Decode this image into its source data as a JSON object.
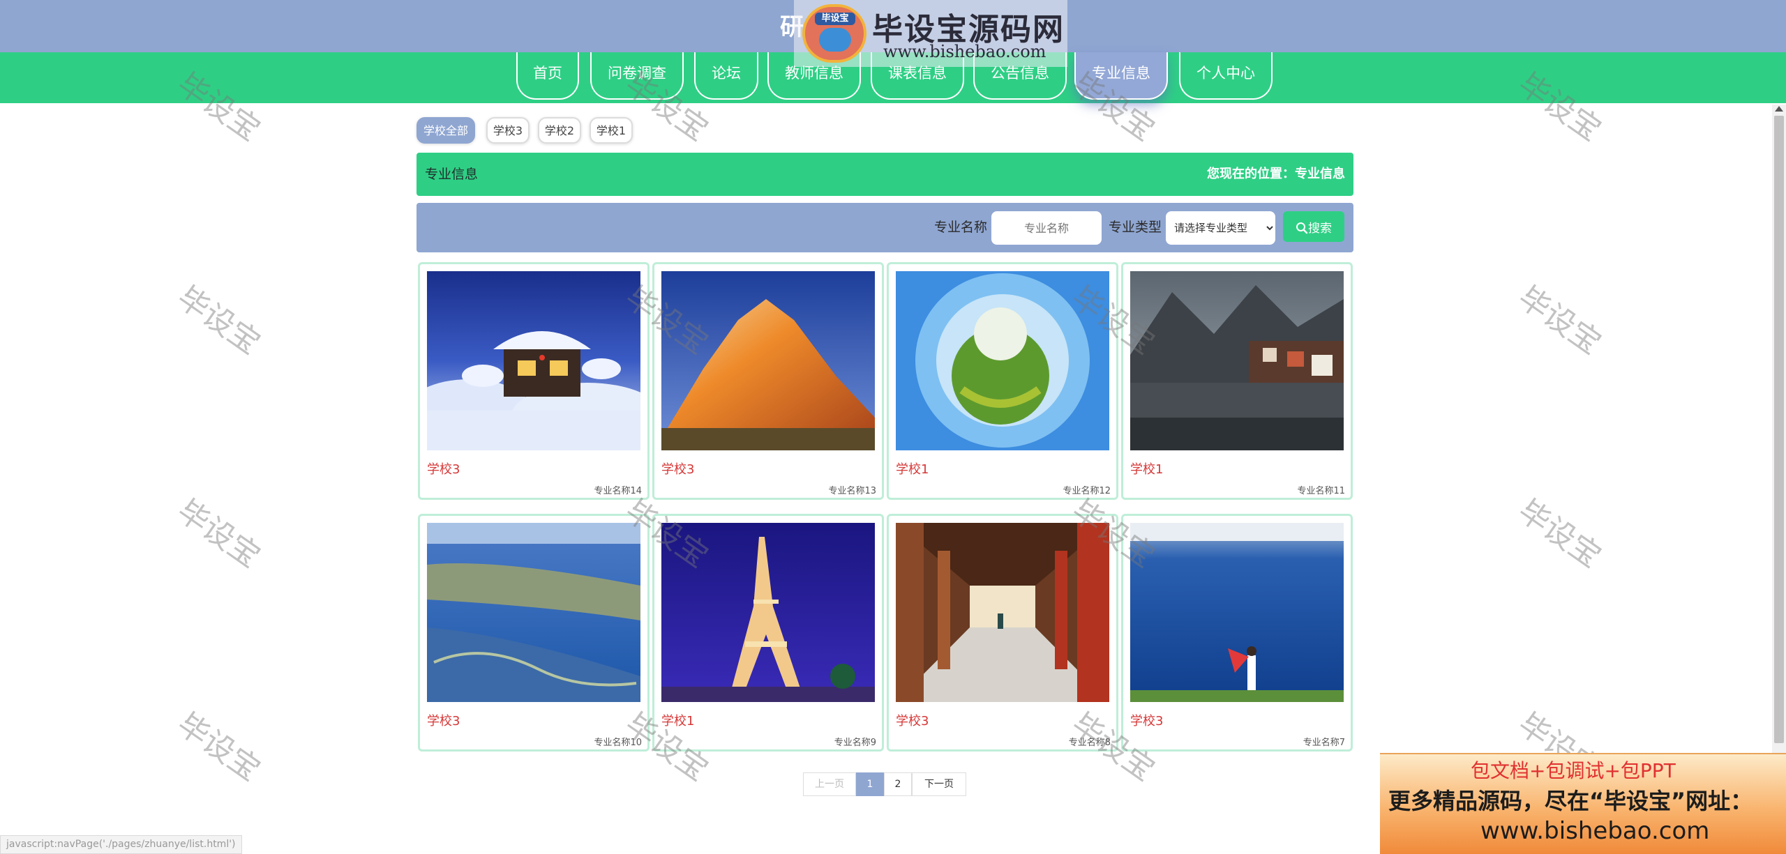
{
  "header": {
    "site_title": "研",
    "logo_cap": "毕设宝",
    "logo_name": "毕设宝源码网",
    "logo_url": "www.bishebao.com"
  },
  "nav": {
    "items": [
      {
        "label": "首页"
      },
      {
        "label": "问卷调查"
      },
      {
        "label": "论坛"
      },
      {
        "label": "教师信息"
      },
      {
        "label": "课表信息"
      },
      {
        "label": "公告信息"
      },
      {
        "label": "专业信息"
      },
      {
        "label": "个人中心"
      }
    ],
    "active": "专业信息"
  },
  "filters": [
    {
      "label": "学校全部",
      "active": true
    },
    {
      "label": "学校3",
      "active": false
    },
    {
      "label": "学校2",
      "active": false
    },
    {
      "label": "学校1",
      "active": false
    }
  ],
  "section": {
    "title": "专业信息",
    "location": "您现在的位置：专业信息"
  },
  "search": {
    "name_label": "专业名称",
    "name_placeholder": "专业名称",
    "type_label": "专业类型",
    "type_selected": "请选择专业类型",
    "button_label": "搜索",
    "button_icon": "search-icon"
  },
  "cards": [
    {
      "school": "学校3",
      "major": "专业名称14",
      "image": "snowy-cabin"
    },
    {
      "school": "学校3",
      "major": "专业名称13",
      "image": "orange-mountain"
    },
    {
      "school": "学校1",
      "major": "专业名称12",
      "image": "tiny-planet"
    },
    {
      "school": "学校1",
      "major": "专业名称11",
      "image": "lake-village"
    },
    {
      "school": "学校3",
      "major": "专业名称10",
      "image": "river-delta"
    },
    {
      "school": "学校1",
      "major": "专业名称9",
      "image": "eiffel-tower"
    },
    {
      "school": "学校3",
      "major": "专业名称8",
      "image": "red-corridor"
    },
    {
      "school": "学校3",
      "major": "专业名称7",
      "image": "woman-by-blue-lake"
    }
  ],
  "pagination": {
    "prev": "上一页",
    "pages": [
      "1",
      "2"
    ],
    "current": "1",
    "next": "下一页"
  },
  "watermark": "毕设宝",
  "promo": {
    "line1": "包文档+包调试+包PPT",
    "line2": "更多精品源码，尽在“毕设宝”网址：",
    "line3": "www.bishebao.com"
  },
  "status_url": "javascript:navPage('./pages/zhuanye/list.html')"
}
